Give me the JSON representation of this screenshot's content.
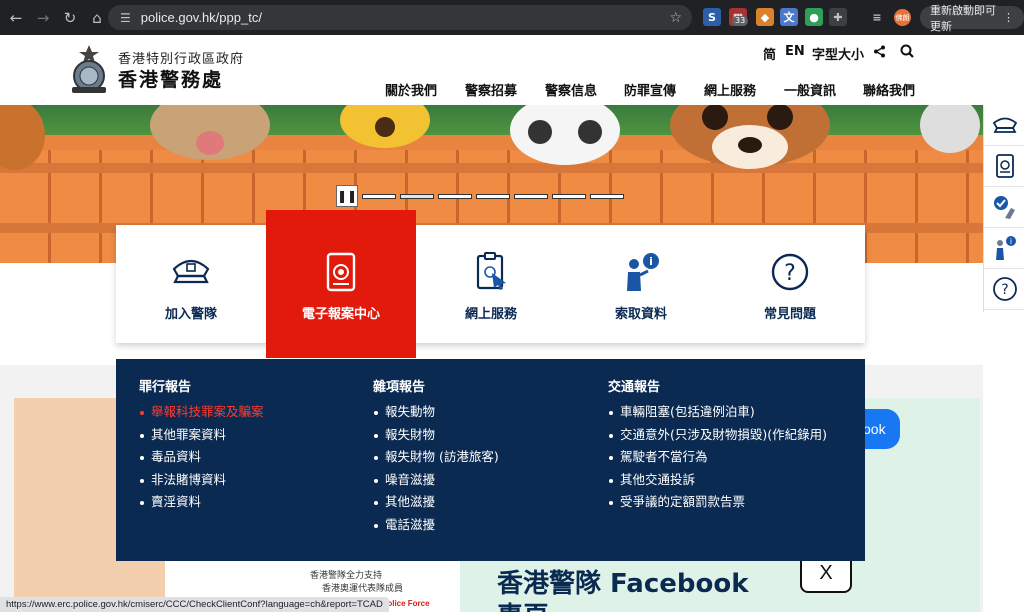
{
  "browser": {
    "url": "police.gov.hk/ppp_tc/",
    "update_button": "重新啟動即可更新",
    "ext_badge": "33",
    "avatar": "佛朗",
    "status_url": "https://www.erc.police.gov.hk/cmiserc/CCC/CheckClientConf?language=ch&report=TCAD"
  },
  "header": {
    "org_small": "香港特別行政區政府",
    "org_big": "香港警務處",
    "util": {
      "simplified": "简",
      "english": "EN",
      "font_size": "字型大小"
    },
    "nav": [
      "關於我們",
      "警察招募",
      "警察信息",
      "防罪宣傳",
      "網上服務",
      "一般資訊",
      "聯絡我們"
    ]
  },
  "tiles": [
    {
      "label": "加入警隊",
      "icon": "police-cap-icon"
    },
    {
      "label": "電子報案中心",
      "icon": "e-report-icon"
    },
    {
      "label": "網上服務",
      "icon": "clipboard-click-icon"
    },
    {
      "label": "索取資料",
      "icon": "info-person-icon"
    },
    {
      "label": "常見問題",
      "icon": "question-icon"
    }
  ],
  "dropdown": {
    "crime": {
      "title": "罪行報告",
      "items": [
        "舉報科技罪案及騙案",
        "其他罪案資料",
        "毒品資料",
        "非法賭博資料",
        "賣淫資料"
      ]
    },
    "misc": {
      "title": "雜項報告",
      "items": [
        "報失動物",
        "報失財物",
        "報失財物 (訪港旅客)",
        "噪音滋擾",
        "其他滋擾",
        "電話滋擾"
      ]
    },
    "traffic": {
      "title": "交通報告",
      "items": [
        "車輛阻塞(包括違例泊車)",
        "交通意外(只涉及財物損毀)(作紀錄用)",
        "駕駛者不當行為",
        "其他交通投訴",
        "受爭議的定額罰款告票"
      ]
    }
  },
  "lower": {
    "fb_pill": "ook",
    "fb_title": "香港警隊 Facebook",
    "fb_sub": "專頁",
    "poster_line1": "香港警隊全力支持",
    "poster_line2": "香港奧運代表隊成員",
    "poster_red": "ng Police Force",
    "x_label": "X"
  },
  "colors": {
    "accent_red": "#e11a0c",
    "navy": "#0b2a52",
    "hot_link": "#ff3b2f"
  }
}
